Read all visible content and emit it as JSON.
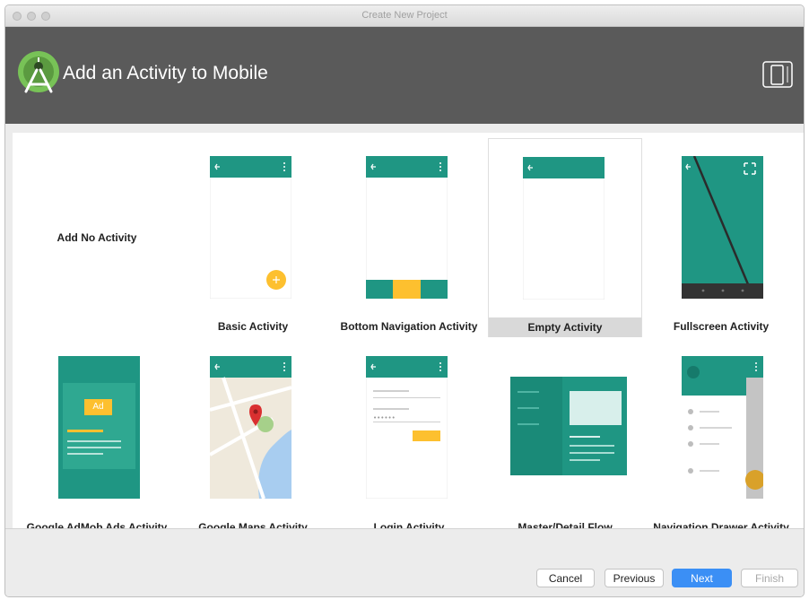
{
  "window": {
    "title": "Create New Project"
  },
  "header": {
    "title": "Add an Activity to Mobile"
  },
  "templates": {
    "no_activity": "Add No Activity",
    "basic": "Basic Activity",
    "bottom_nav": "Bottom Navigation Activity",
    "empty": "Empty Activity",
    "fullscreen": "Fullscreen Activity",
    "admob": "Google AdMob Ads Activity",
    "maps": "Google Maps Activity",
    "login": "Login Activity",
    "master_detail": "Master/Detail Flow",
    "nav_drawer": "Navigation Drawer Activity",
    "admob_badge": "Ad",
    "selected": "Empty Activity"
  },
  "buttons": {
    "cancel": "Cancel",
    "previous": "Previous",
    "next": "Next",
    "finish": "Finish"
  },
  "colors": {
    "teal": "#1f9683",
    "teal_dark": "#167a6b",
    "accent": "#fdc02f",
    "header_bg": "#5a5a5a",
    "button_primary": "#3b8ff5"
  },
  "icons": {
    "logo": "android-studio-logo",
    "device": "phone-tablet-icon"
  }
}
